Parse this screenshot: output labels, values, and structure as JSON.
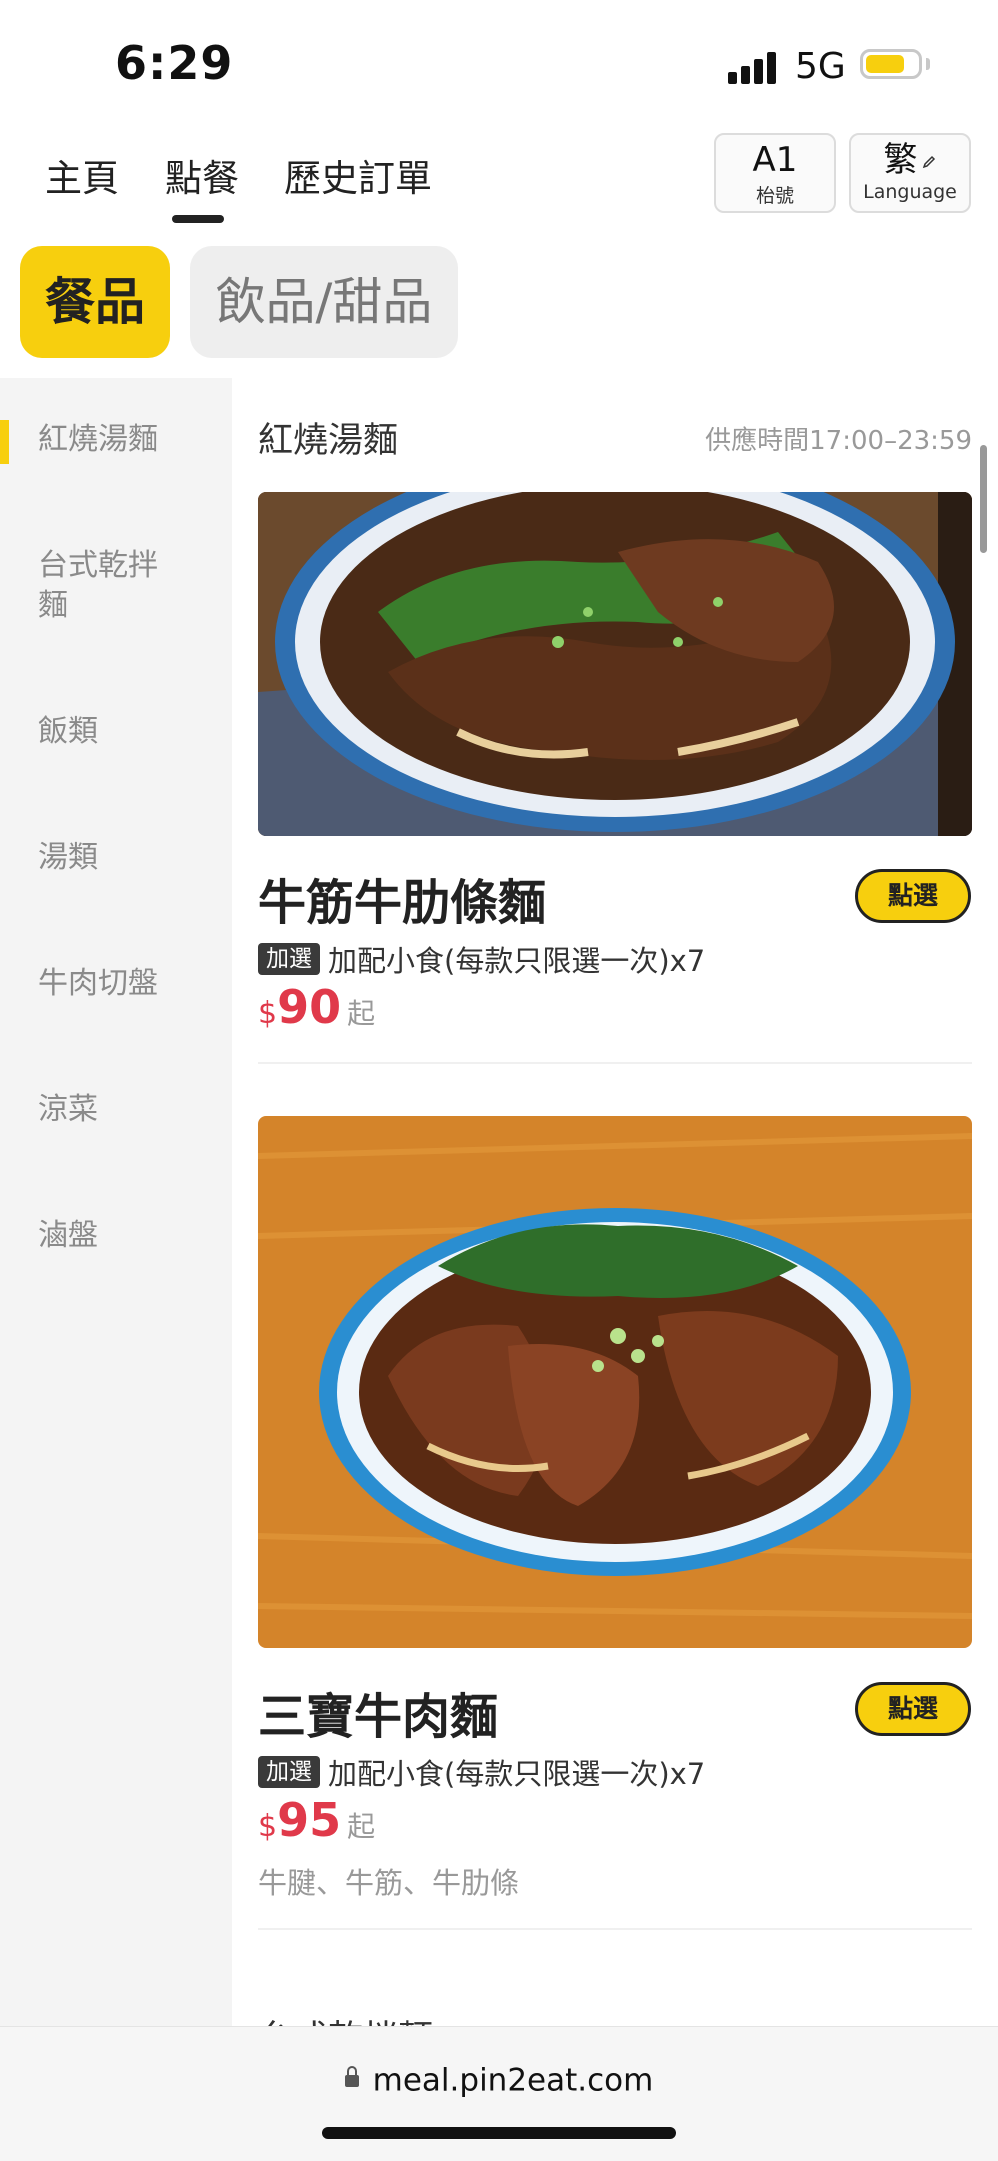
{
  "status_bar": {
    "time": "6:29",
    "network": "5G",
    "battery_color": "#f7cf0e"
  },
  "nav": {
    "tabs": [
      {
        "label": "主頁"
      },
      {
        "label": "點餐"
      },
      {
        "label": "歷史訂單"
      }
    ],
    "active_tab": "點餐",
    "table_button": {
      "number": "A1",
      "label": "枱號"
    },
    "language_button": {
      "char": "繁",
      "label": "Language",
      "icon": "pencil-icon"
    }
  },
  "category_tabs": [
    {
      "label": "餐品",
      "active": true
    },
    {
      "label": "飲品/甜品",
      "active": false
    }
  ],
  "sidebar": {
    "items": [
      {
        "label": "紅燒湯麵"
      },
      {
        "label": "台式乾拌麵"
      },
      {
        "label": "飯類"
      },
      {
        "label": "湯類"
      },
      {
        "label": "牛肉切盤"
      },
      {
        "label": "涼菜"
      },
      {
        "label": "滷盤"
      }
    ],
    "active_index": 0
  },
  "section": {
    "title": "紅燒湯麵",
    "hours": "供應時間17:00–23:59"
  },
  "items": [
    {
      "name": "牛筋牛肋條麵",
      "select_label": "點選",
      "addon_badge": "加選",
      "addon_text": "加配小食(每款只限選一次)x7",
      "currency": "$",
      "price": "90",
      "price_suffix": "起"
    },
    {
      "name": "三寶牛肉麵",
      "select_label": "點選",
      "addon_badge": "加選",
      "addon_text": "加配小食(每款只限選一次)x7",
      "currency": "$",
      "price": "95",
      "price_suffix": "起",
      "description": "牛腱、牛筋、牛肋條"
    }
  ],
  "next_section_title": "台式乾拌麵",
  "bottom_bar": {
    "url": "meal.pin2eat.com"
  },
  "colors": {
    "accent": "#f7cf0e",
    "price": "#e0394a"
  }
}
